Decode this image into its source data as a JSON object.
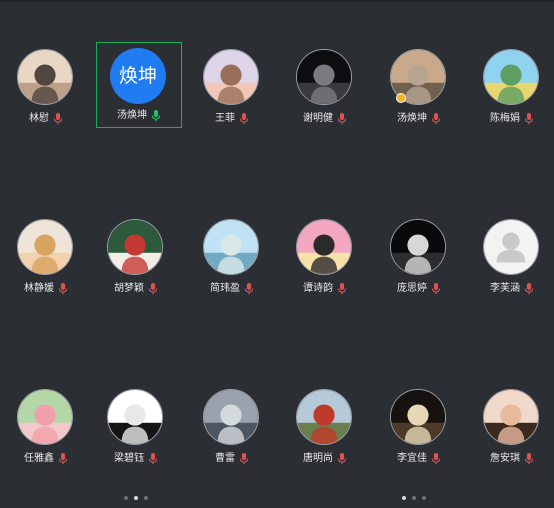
{
  "participants": [
    {
      "name": "林慰",
      "mic": "muted",
      "avatar": "photo-camera-portrait"
    },
    {
      "name": "汤焕坤",
      "mic": "active",
      "avatar": "text",
      "avatar_text": "焕坤",
      "selected": true,
      "avatar_color": "#1f7cf2"
    },
    {
      "name": "王菲",
      "mic": "muted",
      "avatar": "cartoon-figure"
    },
    {
      "name": "谢明健",
      "mic": "muted",
      "avatar": "dark-photo"
    },
    {
      "name": "汤焕坤",
      "mic": "muted",
      "avatar": "outdoor-portrait",
      "badge": "host"
    },
    {
      "name": "陈梅娟",
      "mic": "muted",
      "avatar": "anime-landscape"
    },
    {
      "name": "林静媛",
      "mic": "muted",
      "avatar": "child-photo"
    },
    {
      "name": "胡梦颖",
      "mic": "muted",
      "avatar": "rabbit-figure"
    },
    {
      "name": "简玮盈",
      "mic": "muted",
      "avatar": "seaside-photo"
    },
    {
      "name": "谭诗韵",
      "mic": "muted",
      "avatar": "crayon-cartoon"
    },
    {
      "name": "庞思婷",
      "mic": "muted",
      "avatar": "dark-portrait"
    },
    {
      "name": "李芙涵",
      "mic": "muted",
      "avatar": "default-person"
    },
    {
      "name": "任雅鑫",
      "mic": "muted",
      "avatar": "pig-cartoon"
    },
    {
      "name": "梁碧钰",
      "mic": "muted",
      "avatar": "penguin-cartoon"
    },
    {
      "name": "曹雷",
      "mic": "muted",
      "avatar": "street-photo"
    },
    {
      "name": "唐明尚",
      "mic": "muted",
      "avatar": "garden-photo"
    },
    {
      "name": "李宜佳",
      "mic": "muted",
      "avatar": "night-photo"
    },
    {
      "name": "詹安琪",
      "mic": "muted",
      "avatar": "baby-photo"
    }
  ],
  "pagination_left": {
    "pages": 3,
    "current": 2
  },
  "pagination_right": {
    "pages": 3,
    "current": 1
  },
  "colors": {
    "background": "#2b2e33",
    "muted_mic": "#e0514f",
    "active_mic": "#23c267",
    "selected_border": "#1aad5c"
  }
}
